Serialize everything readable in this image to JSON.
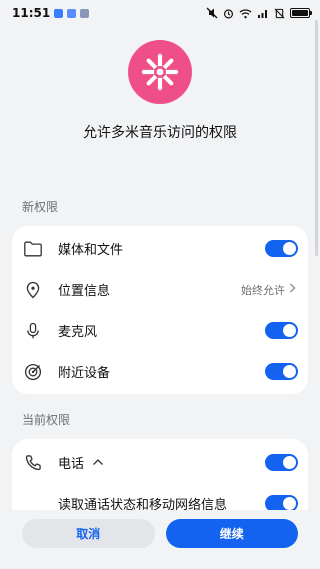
{
  "status_bar": {
    "time": "11:51",
    "notification_icons": [
      "app-icon",
      "app-icon",
      "app-icon"
    ],
    "system_icons": [
      "mute-icon",
      "alarm-icon",
      "wifi-icon",
      "signal-icon",
      "no-sim-icon",
      "battery-icon"
    ]
  },
  "header": {
    "icon": "asterisk-app-icon",
    "title": "允许多米音乐访问的权限"
  },
  "sections": [
    {
      "title": "新权限",
      "items": [
        {
          "icon": "folder-icon",
          "label": "媒体和文件",
          "control": "toggle",
          "on": true
        },
        {
          "icon": "location-icon",
          "label": "位置信息",
          "control": "value",
          "value": "始终允许"
        },
        {
          "icon": "microphone-icon",
          "label": "麦克风",
          "control": "toggle",
          "on": true
        },
        {
          "icon": "nearby-devices-icon",
          "label": "附近设备",
          "control": "toggle",
          "on": true
        }
      ]
    },
    {
      "title": "当前权限",
      "items": [
        {
          "icon": "phone-icon",
          "label": "电话",
          "expand_icon": "chevron-up-icon",
          "control": "toggle",
          "on": true
        },
        {
          "label": "读取通话状态和移动网络信息",
          "control": "toggle",
          "on": true
        }
      ]
    }
  ],
  "footer": {
    "cancel_label": "取消",
    "continue_label": "继续"
  },
  "colors": {
    "accent": "#1462f0",
    "app_icon_bg": "#ef4f87",
    "page_bg": "#f1f3f5"
  }
}
